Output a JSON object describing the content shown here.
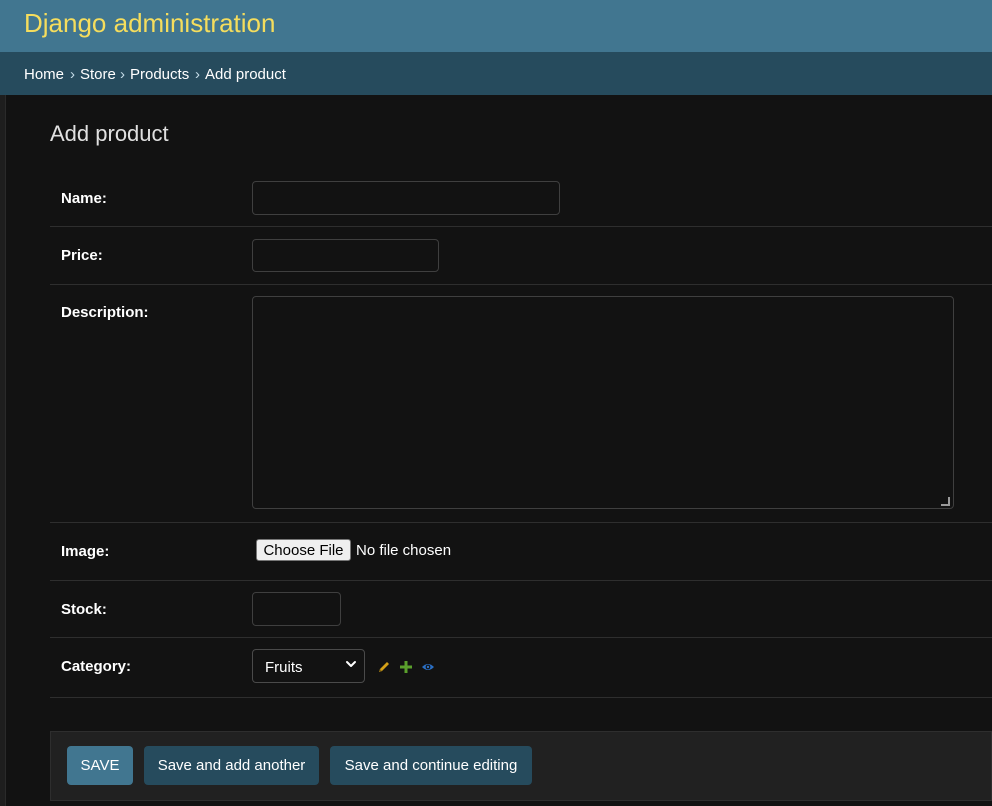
{
  "header": {
    "site_name": "Django administration"
  },
  "breadcrumbs": {
    "items": [
      "Home",
      "Store",
      "Products",
      "Add product"
    ],
    "separator": "›"
  },
  "page": {
    "title": "Add product"
  },
  "form": {
    "name": {
      "label": "Name:",
      "value": ""
    },
    "price": {
      "label": "Price:",
      "value": ""
    },
    "description": {
      "label": "Description:",
      "value": ""
    },
    "image": {
      "label": "Image:",
      "button_label": "Choose File",
      "status": "No file chosen"
    },
    "stock": {
      "label": "Stock:",
      "value": ""
    },
    "category": {
      "label": "Category:",
      "selected": "Fruits",
      "icons": [
        "pencil-icon",
        "plus-icon",
        "eye-icon"
      ]
    }
  },
  "actions": {
    "save": "SAVE",
    "save_add_another": "Save and add another",
    "save_continue": "Save and continue editing"
  },
  "colors": {
    "header_bg": "#417690",
    "site_name": "#f5dd5d",
    "breadcrumbs_bg": "#264b5d",
    "page_bg": "#121212",
    "primary_button": "#417690",
    "secondary_button": "#264b5d",
    "edit_icon": "#d4a017",
    "add_icon": "#5aa02c",
    "view_icon": "#2a6fc4"
  }
}
